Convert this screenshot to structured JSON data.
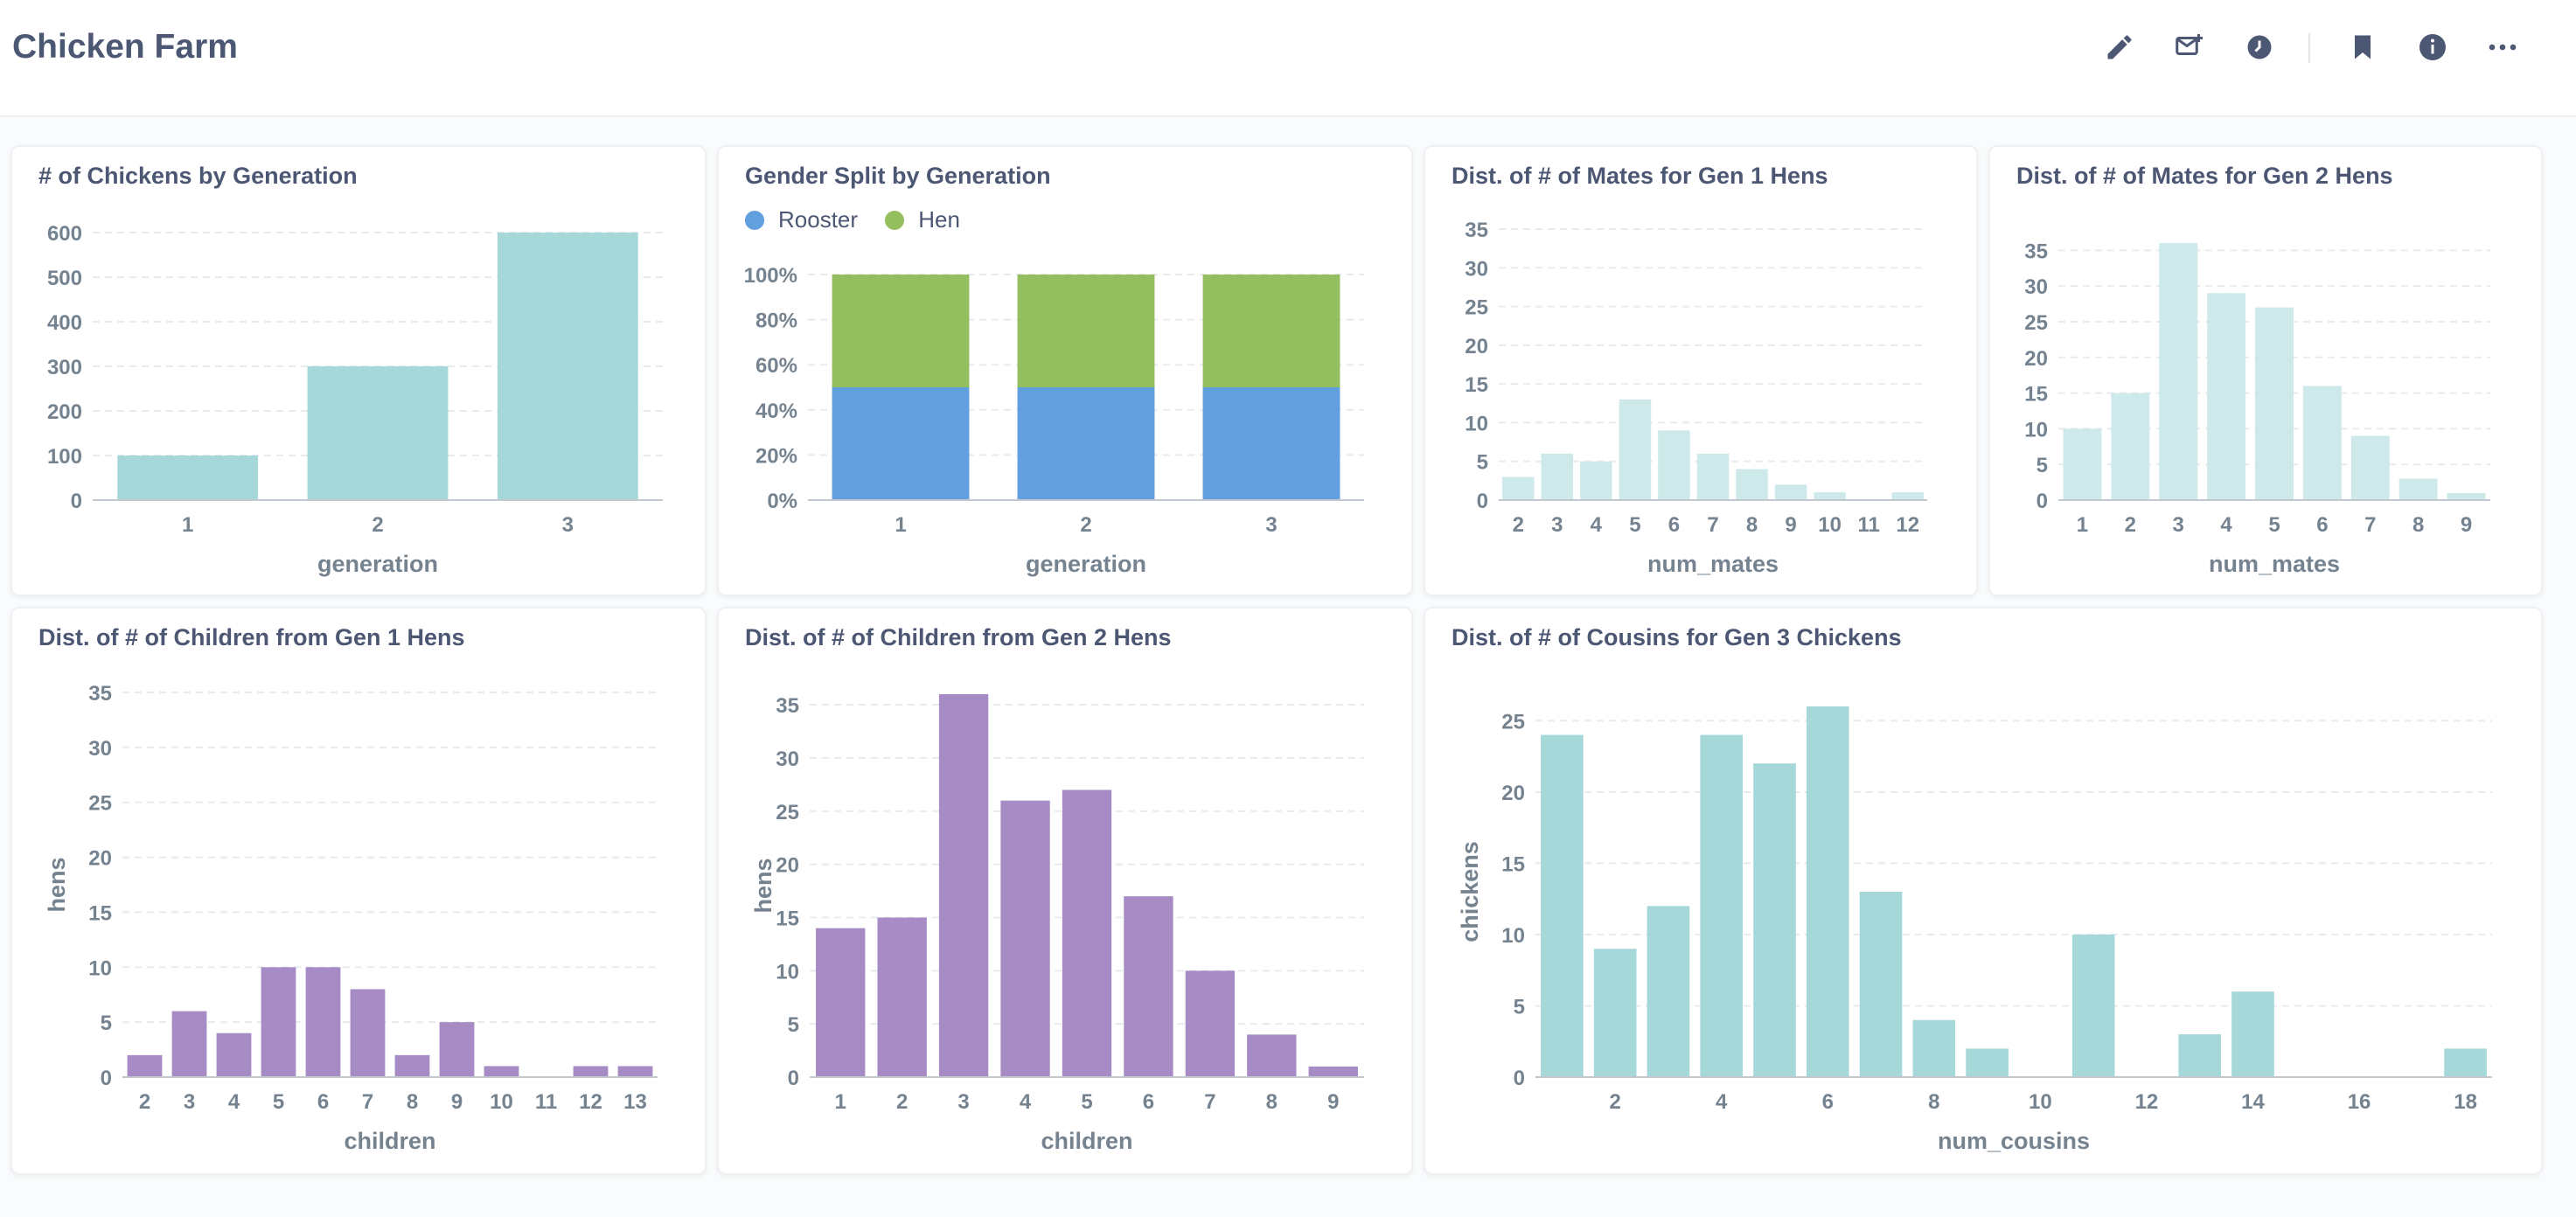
{
  "header": {
    "title": "Chicken Farm",
    "actions": [
      {
        "name": "edit-icon",
        "label": "Edit"
      },
      {
        "name": "subscribe-icon",
        "label": "Subscriptions"
      },
      {
        "name": "history-icon",
        "label": "History"
      },
      {
        "name": "bookmark-icon",
        "label": "Bookmark"
      },
      {
        "name": "info-icon",
        "label": "Info"
      },
      {
        "name": "more-icon",
        "label": "More"
      }
    ]
  },
  "colors": {
    "teal": "#a6d8d9",
    "teal_light": "#cde9ea",
    "purple": "#a78bc4",
    "rooster": "#629fdf",
    "hen": "#95bf5e",
    "axis_text": "#74838f",
    "grid": "#e8ebee"
  },
  "chart_data": [
    {
      "id": "chickens-by-generation",
      "type": "bar",
      "title": "# of Chickens by Generation",
      "xlabel": "generation",
      "ylabel": "",
      "categories": [
        "1",
        "2",
        "3"
      ],
      "values": [
        100,
        300,
        600
      ],
      "ylim": [
        0,
        600
      ],
      "yticks": [
        0,
        100,
        200,
        300,
        400,
        500,
        600
      ],
      "ytick_labels": [
        "0",
        "100",
        "200",
        "300",
        "400",
        "500",
        "600"
      ],
      "color": "#a6d8d9",
      "grid": true
    },
    {
      "id": "gender-split",
      "type": "bar",
      "stacked": true,
      "title": "Gender Split by Generation",
      "xlabel": "generation",
      "ylabel": "",
      "categories": [
        "1",
        "2",
        "3"
      ],
      "series": [
        {
          "name": "Rooster",
          "values": [
            50,
            50,
            50
          ],
          "color": "#629fdf"
        },
        {
          "name": "Hen",
          "values": [
            50,
            50,
            50
          ],
          "color": "#95bf5e"
        }
      ],
      "ylim": [
        0,
        100
      ],
      "yticks": [
        0,
        20,
        40,
        60,
        80,
        100
      ],
      "ytick_labels": [
        "0%",
        "20%",
        "40%",
        "60%",
        "80%",
        "100%"
      ],
      "legend": "top-left",
      "grid": true
    },
    {
      "id": "mates-gen1",
      "type": "bar",
      "title": "Dist. of # of Mates for Gen 1 Hens",
      "xlabel": "num_mates",
      "ylabel": "",
      "categories": [
        "2",
        "3",
        "4",
        "5",
        "6",
        "7",
        "8",
        "9",
        "10",
        "11",
        "12"
      ],
      "values": [
        3,
        6,
        5,
        13,
        9,
        6,
        4,
        2,
        1,
        0,
        1
      ],
      "ylim": [
        0,
        35
      ],
      "yticks": [
        0,
        5,
        10,
        15,
        20,
        25,
        30,
        35
      ],
      "ytick_labels": [
        "0",
        "5",
        "10",
        "15",
        "20",
        "25",
        "30",
        "35"
      ],
      "color": "#cde9ea",
      "grid": true
    },
    {
      "id": "mates-gen2",
      "type": "bar",
      "title": "Dist. of # of Mates for Gen 2 Hens",
      "xlabel": "num_mates",
      "ylabel": "",
      "categories": [
        "1",
        "2",
        "3",
        "4",
        "5",
        "6",
        "7",
        "8",
        "9"
      ],
      "values": [
        10,
        15,
        36,
        29,
        27,
        16,
        9,
        3,
        1
      ],
      "ylim": [
        0,
        37
      ],
      "yticks": [
        0,
        5,
        10,
        15,
        20,
        25,
        30,
        35
      ],
      "ytick_labels": [
        "0",
        "5",
        "10",
        "15",
        "20",
        "25",
        "30",
        "35"
      ],
      "color": "#cde9ea",
      "grid": true
    },
    {
      "id": "children-gen1",
      "type": "bar",
      "title": "Dist. of # of Children from Gen 1 Hens",
      "xlabel": "children",
      "ylabel": "hens",
      "categories": [
        "2",
        "3",
        "4",
        "5",
        "6",
        "7",
        "8",
        "9",
        "10",
        "11",
        "12",
        "13"
      ],
      "values": [
        2,
        6,
        4,
        10,
        10,
        8,
        2,
        5,
        1,
        0,
        1,
        1
      ],
      "ylim": [
        0,
        35
      ],
      "yticks": [
        0,
        5,
        10,
        15,
        20,
        25,
        30,
        35
      ],
      "ytick_labels": [
        "0",
        "5",
        "10",
        "15",
        "20",
        "25",
        "30",
        "35"
      ],
      "color": "#a78bc4",
      "grid": true
    },
    {
      "id": "children-gen2",
      "type": "bar",
      "title": "Dist. of # of Children from Gen 2 Hens",
      "xlabel": "children",
      "ylabel": "hens",
      "categories": [
        "1",
        "2",
        "3",
        "4",
        "5",
        "6",
        "7",
        "8",
        "9"
      ],
      "values": [
        14,
        15,
        36,
        26,
        27,
        17,
        10,
        4,
        1
      ],
      "ylim": [
        0,
        36
      ],
      "yticks": [
        0,
        5,
        10,
        15,
        20,
        25,
        30,
        35
      ],
      "ytick_labels": [
        "0",
        "5",
        "10",
        "15",
        "20",
        "25",
        "30",
        "35"
      ],
      "color": "#a78bc4",
      "grid": true
    },
    {
      "id": "cousins-gen3",
      "type": "bar",
      "title": "Dist. of # of Cousins for Gen 3 Chickens",
      "xlabel": "num_cousins",
      "ylabel": "chickens",
      "x": [
        1,
        2,
        3,
        4,
        5,
        6,
        7,
        8,
        9,
        10,
        11,
        12,
        13,
        14,
        15,
        16,
        17,
        18
      ],
      "values": [
        24,
        9,
        12,
        24,
        22,
        26,
        13,
        4,
        2,
        0,
        10,
        0,
        3,
        6,
        0,
        0,
        0,
        2
      ],
      "xtick_values": [
        2,
        4,
        6,
        8,
        10,
        12,
        14,
        16,
        18
      ],
      "xtick_labels": [
        "2",
        "4",
        "6",
        "8",
        "10",
        "12",
        "14",
        "16",
        "18"
      ],
      "ylim": [
        0,
        26
      ],
      "yticks": [
        0,
        5,
        10,
        15,
        20,
        25
      ],
      "ytick_labels": [
        "0",
        "5",
        "10",
        "15",
        "20",
        "25"
      ],
      "color": "#a6d8d9",
      "grid": true
    }
  ]
}
